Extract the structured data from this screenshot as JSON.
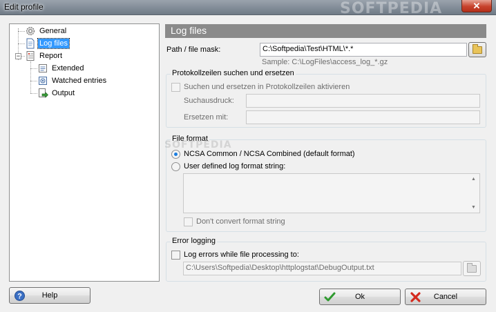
{
  "window": {
    "title": "Edit profile",
    "close_glyph": "✕"
  },
  "tree": {
    "items": [
      {
        "label": "General",
        "icon": "gear-icon"
      },
      {
        "label": "Log files",
        "icon": "document-icon",
        "selected": true
      },
      {
        "label": "Report",
        "icon": "report-icon",
        "expanded": true
      },
      {
        "label": "Extended",
        "icon": "extended-icon"
      },
      {
        "label": "Watched entries",
        "icon": "watched-icon"
      },
      {
        "label": "Output",
        "icon": "output-icon"
      }
    ],
    "expander_glyph": "−"
  },
  "section": {
    "title": "Log files"
  },
  "path": {
    "label": "Path / file mask:",
    "value": "C:\\Softpedia\\Test\\HTML\\*.*",
    "sample": "Sample: C:\\LogFiles\\access_log_*.gz"
  },
  "protokoll": {
    "group_title": "Protokollzeilen suchen und ersetzen",
    "checkbox_label": "Suchen und ersetzen in Protokollzeilen aktivieren",
    "search_label": "Suchausdruck:",
    "replace_label": "Ersetzen mit:",
    "search_value": "",
    "replace_value": ""
  },
  "format": {
    "group_title": "File format",
    "option_ncsa": "NCSA Common / NCSA Combined (default format)",
    "option_user": "User defined log format string:",
    "selected": "ncsa",
    "custom_value": "",
    "dont_convert_label": "Don't convert format string"
  },
  "errorlog": {
    "group_title": "Error logging",
    "checkbox_label": "Log errors while file processing to:",
    "checked": false,
    "path_value": "C:\\Users\\Softpedia\\Desktop\\httplogstat\\DebugOutput.txt"
  },
  "buttons": {
    "help": "Help",
    "ok": "Ok",
    "cancel": "Cancel"
  },
  "watermark": {
    "text": "SOFTPEDIA"
  },
  "colors": {
    "selection": "#3399ff",
    "header_bg": "#8a8a8a",
    "radio_dot": "#1a7de0"
  }
}
